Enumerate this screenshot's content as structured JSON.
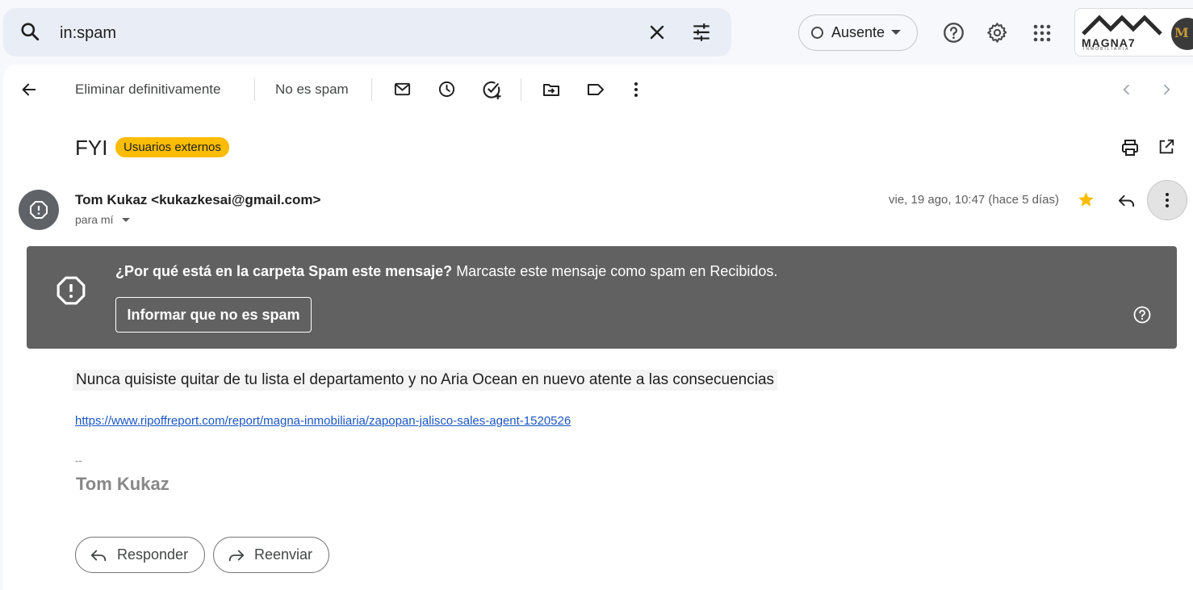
{
  "search": {
    "query": "in:spam"
  },
  "status": {
    "label": "Ausente"
  },
  "account": {
    "logo_text": "MAGNA7",
    "logo_sub": "INMOBILIARIA",
    "avatar_text": "M"
  },
  "toolbar": {
    "delete_forever": "Eliminar definitivamente",
    "not_spam": "No es spam"
  },
  "email": {
    "subject": "FYI",
    "badge": "Usuarios externos",
    "sender": "Tom Kukaz <kukazkesai@gmail.com>",
    "to": "para mí",
    "date": "vie, 19 ago, 10:47 (hace 5 días)",
    "starred": true,
    "body": "Nunca quisiste quitar de tu lista el departamento y no Aria Ocean  en nuevo atente a las consecuencias",
    "link": "https://www.ripoffreport.com/report/magna-inmobiliaria/zapopan-jalisco-sales-agent-1520526",
    "signature_dash": "--",
    "signature_name": "Tom Kukaz"
  },
  "spam_banner": {
    "question": "¿Por qué está en la carpeta Spam este mensaje?",
    "reason": " Marcaste este mensaje como spam en Recibidos.",
    "button": "Informar que no es spam"
  },
  "actions": {
    "reply": "Responder",
    "forward": "Reenviar"
  },
  "colors": {
    "badge": "#fbbc04",
    "banner": "#616161",
    "star": "#fbbc04",
    "link": "#1a56c4"
  }
}
